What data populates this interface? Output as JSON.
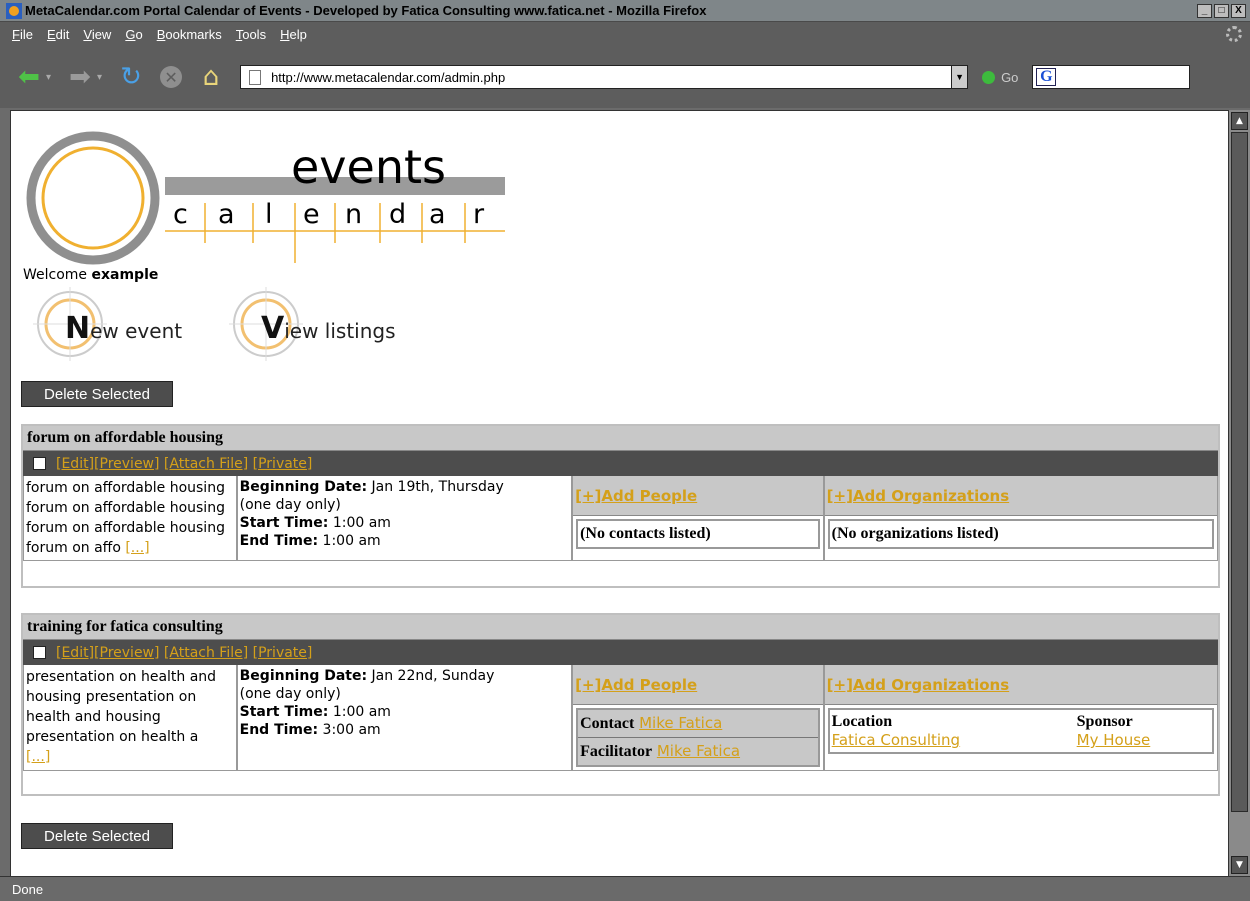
{
  "window": {
    "title": "MetaCalendar.com Portal Calendar of Events - Developed by Fatica Consulting www.fatica.net - Mozilla Firefox",
    "buttons": [
      "_",
      "□",
      "X"
    ]
  },
  "menu": [
    "File",
    "Edit",
    "View",
    "Go",
    "Bookmarks",
    "Tools",
    "Help"
  ],
  "navbar": {
    "url": "http://www.metacalendar.com/admin.php",
    "go_label": "Go",
    "search_value": ""
  },
  "logo": {
    "line1": "events",
    "line2": [
      "c",
      "a",
      "l",
      "e",
      "n",
      "d",
      "a",
      "r"
    ]
  },
  "welcome": {
    "prefix": "Welcome ",
    "user": "example"
  },
  "big_buttons": {
    "new": {
      "initial": "N",
      "rest": "ew event"
    },
    "view": {
      "initial": "V",
      "rest": "iew listings"
    }
  },
  "delete_label": "Delete Selected",
  "actions": {
    "edit": "[Edit]",
    "preview": "[Preview]",
    "attach": "[Attach File]",
    "private": "[Private]"
  },
  "labels": {
    "beginning": "Beginning Date:",
    "start": "Start Time:",
    "end": "End Time:",
    "add_people": "[+]Add People",
    "add_orgs": "[+]Add Organizations",
    "no_contacts": "(No contacts listed)",
    "no_orgs": "(No organizations listed)",
    "more": "[...]"
  },
  "events": [
    {
      "title": "forum on affordable housing",
      "description": "forum on affordable housing forum on affordable housing forum on affordable housing forum on affo ",
      "beginning": " Jan 19th, Thursday",
      "duration": "(one day only)",
      "start": " 1:00 am",
      "end": " 1:00 am"
    },
    {
      "title": "training for fatica consulting",
      "description": "presentation on health and housing presentation on health and housing presentation on health a",
      "beginning": " Jan 22nd, Sunday",
      "duration": "(one day only)",
      "start": " 1:00 am",
      "end": " 3:00 am",
      "people": [
        {
          "role": "Contact",
          "name": "Mike Fatica"
        },
        {
          "role": "Facilitator",
          "name": "Mike Fatica"
        }
      ],
      "orgs": [
        {
          "role": "Location",
          "name": "Fatica Consulting"
        },
        {
          "role": "Sponsor",
          "name": "My House"
        }
      ]
    }
  ],
  "status": "Done",
  "colors": {
    "link": "#d4a01a",
    "header_grey": "#c8c8c8",
    "action_bar": "#4d4d4d"
  }
}
